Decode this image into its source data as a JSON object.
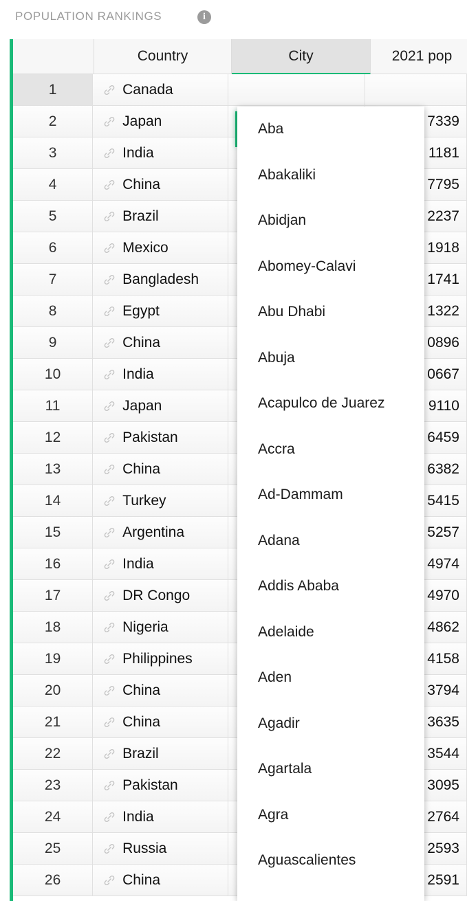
{
  "card": {
    "title": "POPULATION RANKINGS",
    "info_icon": "info-icon",
    "info_glyph": "i",
    "accent_color": "#1aba78"
  },
  "table": {
    "columns": [
      {
        "key": "index",
        "label": ""
      },
      {
        "key": "country",
        "label": "Country"
      },
      {
        "key": "city",
        "label": "City"
      },
      {
        "key": "pop",
        "label": "2021 pop"
      }
    ],
    "selected_column": "City",
    "selected_cell": {
      "row": 1,
      "column": "City",
      "value": ""
    },
    "rows": [
      {
        "index": "1",
        "country": "Canada",
        "pop": ""
      },
      {
        "index": "2",
        "country": "Japan",
        "pop": "7339"
      },
      {
        "index": "3",
        "country": "India",
        "pop": "1181"
      },
      {
        "index": "4",
        "country": "China",
        "pop": "7795"
      },
      {
        "index": "5",
        "country": "Brazil",
        "pop": "2237"
      },
      {
        "index": "6",
        "country": "Mexico",
        "pop": "1918"
      },
      {
        "index": "7",
        "country": "Bangladesh",
        "pop": "1741"
      },
      {
        "index": "8",
        "country": "Egypt",
        "pop": "1322"
      },
      {
        "index": "9",
        "country": "China",
        "pop": "0896"
      },
      {
        "index": "10",
        "country": "India",
        "pop": "0667"
      },
      {
        "index": "11",
        "country": "Japan",
        "pop": "9110"
      },
      {
        "index": "12",
        "country": "Pakistan",
        "pop": "6459"
      },
      {
        "index": "13",
        "country": "China",
        "pop": "6382"
      },
      {
        "index": "14",
        "country": "Turkey",
        "pop": "5415"
      },
      {
        "index": "15",
        "country": "Argentina",
        "pop": "5257"
      },
      {
        "index": "16",
        "country": "India",
        "pop": "4974"
      },
      {
        "index": "17",
        "country": "DR Congo",
        "pop": "4970"
      },
      {
        "index": "18",
        "country": "Nigeria",
        "pop": "4862"
      },
      {
        "index": "19",
        "country": "Philippines",
        "pop": "4158"
      },
      {
        "index": "20",
        "country": "China",
        "pop": "3794"
      },
      {
        "index": "21",
        "country": "China",
        "pop": "3635"
      },
      {
        "index": "22",
        "country": "Brazil",
        "pop": "3544"
      },
      {
        "index": "23",
        "country": "Pakistan",
        "pop": "3095"
      },
      {
        "index": "24",
        "country": "India",
        "pop": "2764"
      },
      {
        "index": "25",
        "country": "Russia",
        "pop": "2593"
      },
      {
        "index": "26",
        "country": "China",
        "pop": "2591"
      }
    ]
  },
  "dropdown": {
    "open": true,
    "options": [
      "Aba",
      "Abakaliki",
      "Abidjan",
      "Abomey-Calavi",
      "Abu Dhabi",
      "Abuja",
      "Acapulco de Juarez",
      "Accra",
      "Ad-Dammam",
      "Adana",
      "Addis Ababa",
      "Adelaide",
      "Aden",
      "Agadir",
      "Agartala",
      "Agra",
      "Aguascalientes"
    ]
  }
}
